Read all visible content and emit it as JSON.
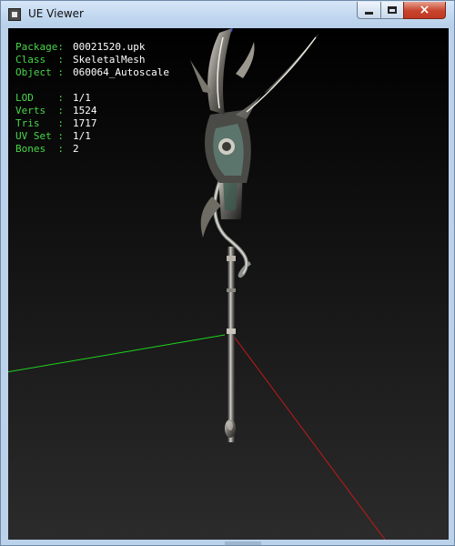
{
  "window": {
    "title": "UE Viewer",
    "icon": "app-icon",
    "controls": {
      "minimize": "minimize-icon",
      "maximize": "maximize-icon",
      "close": "×"
    }
  },
  "info": {
    "package": {
      "label": "Package:",
      "value": "00021520.upk"
    },
    "class": {
      "label": "Class  :",
      "value": "SkeletalMesh"
    },
    "object": {
      "label": "Object :",
      "value": "060064_Autoscale"
    },
    "lod": {
      "label": "LOD    :",
      "value": "1/1"
    },
    "verts": {
      "label": "Verts  :",
      "value": "1524"
    },
    "tris": {
      "label": "Tris   :",
      "value": "1717"
    },
    "uvset": {
      "label": "UV Set :",
      "value": "1/1"
    },
    "bones": {
      "label": "Bones  :",
      "value": "2"
    }
  },
  "colors": {
    "label_green": "#49d649",
    "axis_x": "#c11a1a",
    "axis_y": "#1ed41e",
    "axis_z": "#1a2fd6"
  }
}
